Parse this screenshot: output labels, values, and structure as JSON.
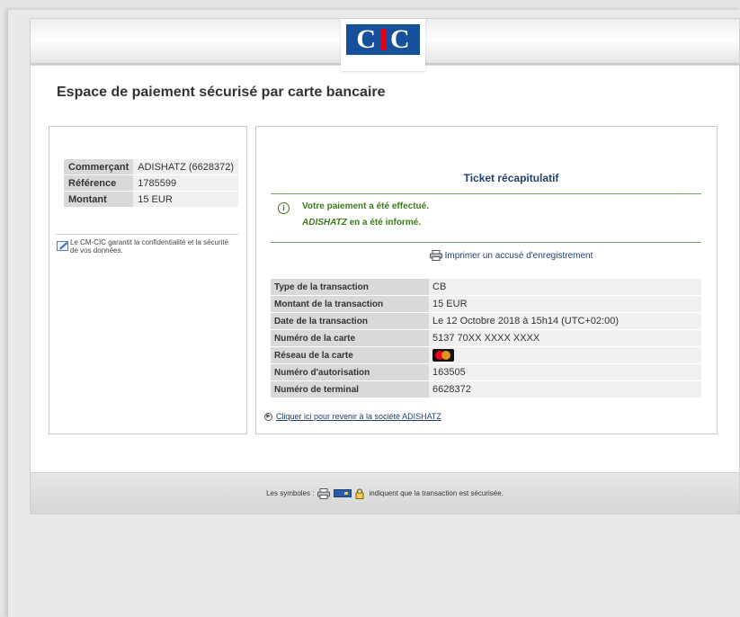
{
  "logo": {
    "text_left": "C",
    "text_right": "C",
    "bar_color": "#e2001a",
    "bg_color": "#164f9c"
  },
  "page_title": "Espace de paiement sécurisé par carte bancaire",
  "merchant_info": {
    "rows": [
      {
        "label": "Commerçant",
        "value": "ADISHATZ (6628372)"
      },
      {
        "label": "Référence",
        "value": "1785599"
      },
      {
        "label": "Montant",
        "value": "15 EUR"
      }
    ]
  },
  "security_note": "Le CM-CIC garantit la confidentialité et la sécurité de vos données.",
  "ticket": {
    "title": "Ticket récapitulatif",
    "message_1": "Votre paiement a été effectué.",
    "message_2_merchant": "ADISHATZ",
    "message_2_rest": " en a été informé.",
    "print_label": "Imprimer un accusé d'enregistrement",
    "rows": [
      {
        "label": "Type de la transaction",
        "value": "CB"
      },
      {
        "label": "Montant de la transaction",
        "value": "15 EUR"
      },
      {
        "label": "Date de la transaction",
        "value": "Le 12 Octobre 2018 à 15h14 (UTC+02:00)"
      },
      {
        "label": "Numéro de la carte",
        "value": "5137 70XX XXXX XXXX"
      },
      {
        "label": "Réseau de la carte",
        "value": ""
      },
      {
        "label": "Numéro d'autorisation",
        "value": "163505"
      },
      {
        "label": "Numéro de terminal",
        "value": "6628372"
      }
    ],
    "card_network_icon": "mastercard-icon",
    "back_link": "Cliquer ici pour revenir à la société ADISHATZ"
  },
  "footer": {
    "prefix": "Les symboles :",
    "suffix": "indiquent que la transaction est sécurisée."
  },
  "colors": {
    "accent_blue": "#22426c",
    "success_green": "#3d7a1c"
  }
}
